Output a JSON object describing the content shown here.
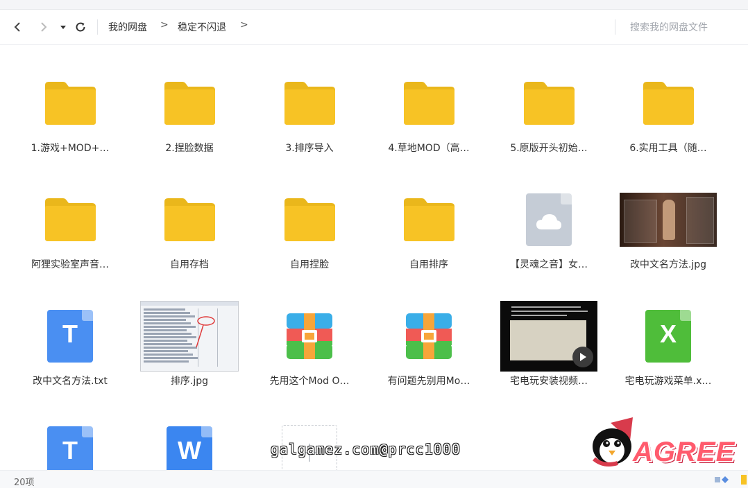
{
  "nav": {
    "breadcrumb": [
      "我的网盘",
      "稳定不闪退"
    ],
    "separator": ">",
    "search_placeholder": "搜索我的网盘文件"
  },
  "items": [
    {
      "label": "1.游戏+MOD+…",
      "type": "folder"
    },
    {
      "label": "2.捏脸数据",
      "type": "folder"
    },
    {
      "label": "3.排序导入",
      "type": "folder"
    },
    {
      "label": "4.草地MOD（高…",
      "type": "folder"
    },
    {
      "label": "5.原版开头初始…",
      "type": "folder"
    },
    {
      "label": "6.实用工具（随…",
      "type": "folder"
    },
    {
      "label": "阿狸实验室声音…",
      "type": "folder"
    },
    {
      "label": "自用存档",
      "type": "folder"
    },
    {
      "label": "自用捏脸",
      "type": "folder"
    },
    {
      "label": "自用排序",
      "type": "folder"
    },
    {
      "label": "【灵魂之音】女…",
      "type": "cloud-file"
    },
    {
      "label": "改中文名方法.jpg",
      "type": "image-game"
    },
    {
      "label": "改中文名方法.txt",
      "type": "txt",
      "letter": "T"
    },
    {
      "label": "排序.jpg",
      "type": "image-screenshot"
    },
    {
      "label": "先用这个Mod O…",
      "type": "archive"
    },
    {
      "label": "有问题先别用Mo…",
      "type": "archive"
    },
    {
      "label": "宅电玩安装视频…",
      "type": "video"
    },
    {
      "label": "宅电玩游戏菜单.x…",
      "type": "excel",
      "letter": "X"
    },
    {
      "label": "",
      "type": "txt",
      "letter": "T"
    },
    {
      "label": "",
      "type": "word",
      "letter": "W"
    },
    {
      "label": "",
      "type": "new"
    }
  ],
  "status": {
    "count": "20项"
  },
  "watermark": "galgamez.com@prcc1000",
  "brand_logo_text": "AGREE",
  "colors": {
    "folder": "#f7c325",
    "folder_tab": "#eab71b",
    "txt": "#4a8ff2",
    "word": "#3b86f0",
    "excel": "#4fbd3a",
    "cloud_doc": "#c5ccd6"
  }
}
